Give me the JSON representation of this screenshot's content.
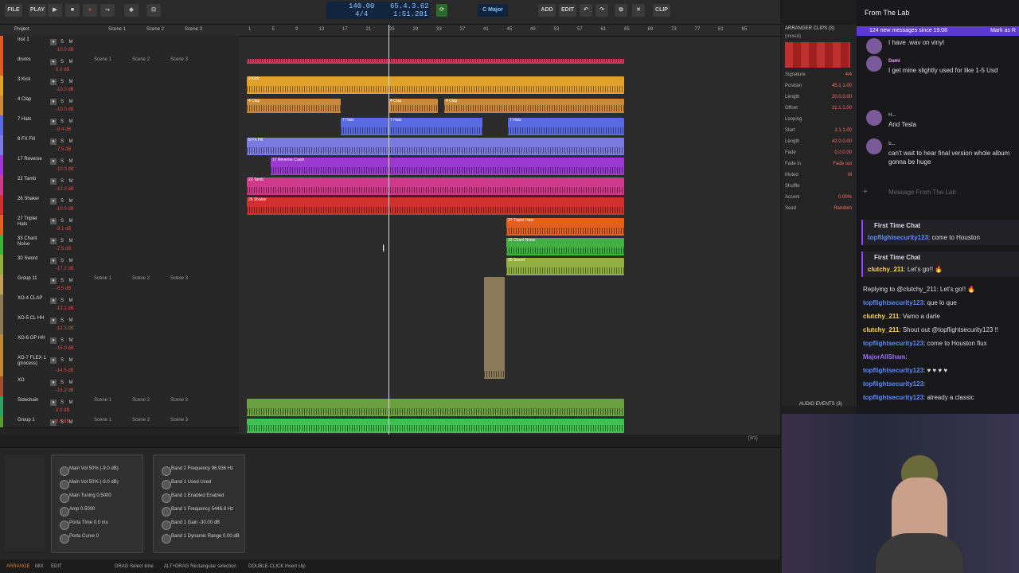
{
  "toolbar": {
    "file": "FILE",
    "play": "PLAY",
    "add": "ADD",
    "edit": "EDIT",
    "clip": "CLIP"
  },
  "transport": {
    "tempo": "140.00",
    "signature": "4/4",
    "position": "65.4.3.62",
    "time": "1:51.281",
    "key": "C Major"
  },
  "ruler_ticks": [
    "1",
    "5",
    "9",
    "13",
    "17",
    "21",
    "25",
    "29",
    "33",
    "37",
    "41",
    "45",
    "49",
    "53",
    "57",
    "61",
    "65",
    "69",
    "73",
    "77",
    "81",
    "85"
  ],
  "tracks": [
    {
      "name": "Inst 1",
      "vol": "-10.0 dB",
      "color": "#e05a2a"
    },
    {
      "name": "drums",
      "vol": "0.0 dB",
      "color": "#e05a2a",
      "scenes": true
    },
    {
      "name": "3 Kick",
      "vol": "-10.0 dB",
      "color": "#e0a22a"
    },
    {
      "name": "4 Clap",
      "vol": "-10.0 dB",
      "color": "#c88a3a"
    },
    {
      "name": "7 Hats",
      "vol": "-8.4 dB",
      "color": "#5a6ae0"
    },
    {
      "name": "8 FX Fill",
      "vol": "-7.5 dB",
      "color": "#7a7ae0"
    },
    {
      "name": "17 Reverse",
      "vol": "-10.0 dB",
      "color": "#9a3ad0"
    },
    {
      "name": "22 Tamb",
      "vol": "-12.3 dB",
      "color": "#d03a8a"
    },
    {
      "name": "26 Shaker",
      "vol": "-10.0 dB",
      "color": "#d03030"
    },
    {
      "name": "27 Triplet Hats",
      "vol": "-9.1 dB",
      "color": "#e06020"
    },
    {
      "name": "33 Chant Noise",
      "vol": "-7.5 dB",
      "color": "#40b040"
    },
    {
      "name": "30 Sword",
      "vol": "-17.2 dB",
      "color": "#90b040"
    },
    {
      "name": "Group 11",
      "vol": "-6.5 dB",
      "color": "#c0a060",
      "scenes": true
    },
    {
      "name": "XO-4 CLAP",
      "vol": "-13.1 dB",
      "color": "#8a7a5a"
    },
    {
      "name": "XO-5 CL HH",
      "vol": "-12.3 dB",
      "color": "#8a7a5a"
    },
    {
      "name": "XO-6 OP HH",
      "vol": "-15.0 dB",
      "color": "#c08a3a"
    },
    {
      "name": "XO-7 FLEX 1 (process)",
      "vol": "-14.5 dB",
      "color": "#c08a3a"
    },
    {
      "name": "XO",
      "vol": "-16.2 dB",
      "color": "#a05030"
    },
    {
      "name": "Sidechain",
      "vol": "0.0 dB",
      "color": "#30a060",
      "scenes": true
    },
    {
      "name": "Group 1",
      "vol": "0.0 dB",
      "color": "#5a9a3a",
      "scenes": true
    }
  ],
  "scene_labels": [
    "Scene 1",
    "Scene 2",
    "Scene 3"
  ],
  "clip_labels": {
    "kick": "3 Kick",
    "clap": "4 Clap",
    "hats": "7 Hats",
    "fx": "8 FX Fill",
    "reverse": "17 Reverse Crash",
    "tamb": "22 Tamb",
    "shaker": "26 Shaker",
    "triplet": "27 Triplet Hats",
    "chant": "33 Chant Noise",
    "sword": "30 Sword"
  },
  "inspector": {
    "header": "ARRANGER CLIPS (3)",
    "sub": "(mixed)",
    "rows": [
      {
        "k": "Signature",
        "v": "4/4"
      },
      {
        "k": "Position",
        "v": "45.1.1.00"
      },
      {
        "k": "Length",
        "v": "20.0.0.00"
      },
      {
        "k": "Offset",
        "v": "21.1.1.00"
      },
      {
        "k": "Looping",
        "v": ""
      },
      {
        "k": "Start",
        "v": "1.1.1.00"
      },
      {
        "k": "Length",
        "v": "42.0.0.00"
      },
      {
        "k": "Fade",
        "v": "0.0.0.00"
      },
      {
        "k": "Fade in",
        "v": "Fade out"
      },
      {
        "k": "Muted",
        "v": "M"
      },
      {
        "k": "Shuffle",
        "v": ""
      },
      {
        "k": "Accent",
        "v": "0.00%"
      },
      {
        "k": "Seed",
        "v": "Random"
      }
    ],
    "audio_events": "AUDIO EVENTS (3)"
  },
  "chat": {
    "channel": "From The Lab",
    "banner": "124 new messages since 19:08",
    "mark": "Mark as R",
    "messages": [
      {
        "name": "",
        "text": "I have .wav on vinyl",
        "color": "#ddd"
      },
      {
        "name": "Dami",
        "text": "I get mine slightly used for like 1-5 Usd",
        "color": "#e8a0ff"
      },
      {
        "name": "H...",
        "text": "And Tesla",
        "color": "#999"
      },
      {
        "name": "b...",
        "text": "can't wait to hear final version whole album gonna be huge",
        "color": "#999"
      }
    ],
    "placeholder": "Message From The Lab",
    "first_chat": "First Time Chat",
    "m1": {
      "name": "topflightsecurity123",
      "text": ": come to Houston",
      "color": "#5b8cff"
    },
    "m2": {
      "name": "clutchy_211",
      "text": ": Let's go!! 🔥",
      "color": "#ffd84a"
    },
    "rest": [
      {
        "name": "",
        "text": "Replying to @clutchy_211: Let's go!! 🔥",
        "color": "#aaa"
      },
      {
        "name": "topflightsecurity123",
        "text": ": que lo que",
        "color": "#5b8cff"
      },
      {
        "name": "clutchy_211",
        "text": ": Vamo a darle",
        "color": "#ffd84a"
      },
      {
        "name": "clutchy_211",
        "text": ": Shout out @topflightsecurity123 !!",
        "color": "#ffd84a"
      },
      {
        "name": "topflightsecurity123",
        "text": ": come to Houston flux",
        "color": "#5b8cff"
      },
      {
        "name": "MajorAllSham",
        "text": ":",
        "color": "#9a6bff"
      },
      {
        "name": "topflightsecurity123",
        "text": ": ♥ ♥ ♥ ♥",
        "color": "#5b8cff"
      },
      {
        "name": "topflightsecurity123",
        "text": ":",
        "color": "#5b8cff"
      },
      {
        "name": "topflightsecurity123",
        "text": ": already a classic",
        "color": "#5b8cff"
      }
    ]
  },
  "devices": {
    "d1": [
      "Main Vol 50% (-9.0 dB)",
      "Main Vol 50% (-9.0 dB)",
      "Main Tuning 0.5000",
      "Amp 0.5000",
      "Porta Time 0.0 ms",
      "Porta Curve 0"
    ],
    "d2": [
      "Band 2 Frequency 96.936 Hz",
      "Band 1 Used Used",
      "Band 1 Enabled Enabled",
      "Band 1 Frequency 5446.8 Hz",
      "Band 1 Gain -30.00 dB",
      "Band 1 Dynamic Range 0.00 dB"
    ]
  },
  "statusbar": [
    "ARRANGE",
    "MIX",
    "EDIT",
    "DRAG Select time",
    "ALT+DRAG Rectangular selection",
    "DOUBLE-CLICK Insert clip"
  ],
  "track_count": "[3/1]"
}
